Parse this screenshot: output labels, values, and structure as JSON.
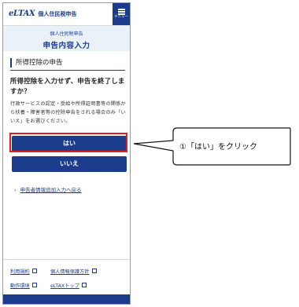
{
  "header": {
    "logo_mark": "eLTAX",
    "logo_sub": "個人住民税申告",
    "menu_label": "メニュー"
  },
  "subheader": {
    "small": "個人住民税申告",
    "title": "申告内容入力"
  },
  "main": {
    "section_title": "所得控除の申告",
    "question": "所得控除を入力せず、申告を終了しますか？",
    "description": "行政サービスの認定・受給や所得証明書等の関係から扶養・障害者等の控除申告をされる場合のみ「いいえ」をお選びください。",
    "yes_label": "はい",
    "no_label": "いいえ",
    "back_link": "申告者情報追加入力へ戻る"
  },
  "footer": {
    "links": [
      "利用規約",
      "個人情報保護方針",
      "動作環境",
      "eLTAXトップ"
    ]
  },
  "callout": {
    "text": "①「はい」をクリック"
  },
  "colors": {
    "brand": "#1a3c8a",
    "highlight": "#e02020"
  }
}
